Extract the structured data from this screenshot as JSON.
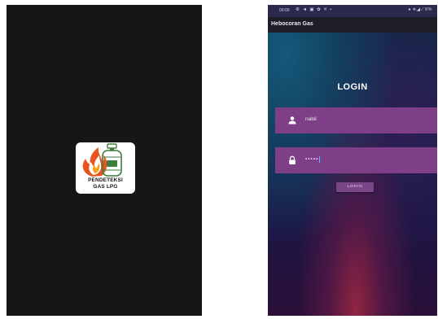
{
  "splash": {
    "logo_line1": "PENDETEKSI",
    "logo_line2": "GAS LPG",
    "logo_icon": "gas-cylinder-flame-icon"
  },
  "statusbar": {
    "time": "00:00",
    "left_icons": "⚙ ◄ ▣ ✿ ✕ •",
    "right_icons": "● ▾ᵢ◢ ⁄ 8%"
  },
  "appbar": {
    "title": "Hebocoran Gas"
  },
  "login": {
    "heading": "LOGIN",
    "username_value": "nabil",
    "password_value": "•••••",
    "button_label": "LOGIN"
  },
  "colors": {
    "field_bg": "#7f3e88",
    "button_bg": "#7b4688",
    "splash_bg": "#161616"
  }
}
